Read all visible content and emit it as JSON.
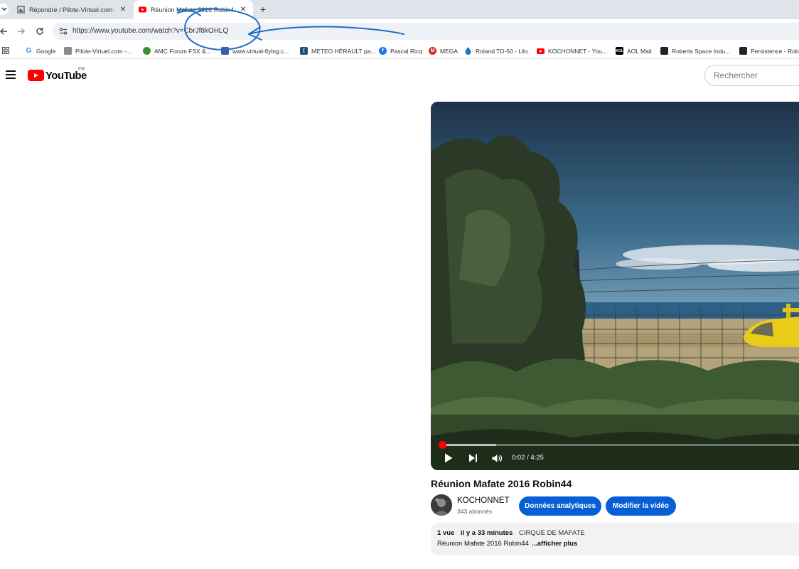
{
  "browser": {
    "tabs": [
      {
        "title": "Répondre / Pilote-Virtuel.com -",
        "favicon": "pilote-virtuel-icon",
        "active": false
      },
      {
        "title": "Réunion Mafate 2016 Robin44",
        "favicon": "youtube-icon",
        "active": true
      }
    ],
    "url": "https://www.youtube.com/watch?v=CbrJf8kOHLQ",
    "bookmarks": [
      {
        "label": "Google",
        "icon": "google-icon",
        "color": "#4285f4"
      },
      {
        "label": "Pilote-Virtuel.com -...",
        "icon": "pilote-virtuel-icon",
        "color": "#7a7a7a"
      },
      {
        "label": "AMC Forum FSX &...",
        "icon": "globe-icon",
        "color": "#3a8f3a"
      },
      {
        "label": "www.virtual-flying.c...",
        "icon": "virtual-flying-icon",
        "color": "#3b5ba8"
      },
      {
        "label": "METEO HÉRAULT pa...",
        "icon": "meteo-icon",
        "color": "#1c4f7c"
      },
      {
        "label": "Pascal Ricq",
        "icon": "facebook-icon",
        "color": "#1877f2"
      },
      {
        "label": "MEGA",
        "icon": "mega-icon",
        "color": "#d9272e"
      },
      {
        "label": "Roland TD-50 - Lilo",
        "icon": "drop-icon",
        "color": "#1a73c8"
      },
      {
        "label": "KOCHONNET - You...",
        "icon": "youtube-icon",
        "color": "#ff0000"
      },
      {
        "label": "AOL Mail",
        "icon": "aol-icon",
        "color": "#000000"
      },
      {
        "label": "Roberts Space Indu...",
        "icon": "rsi-icon",
        "color": "#222222"
      },
      {
        "label": "Persistence - Robe",
        "icon": "rsi-icon",
        "color": "#222222"
      }
    ]
  },
  "youtube": {
    "logo_text": "YouTube",
    "region": "FR",
    "search_placeholder": "Rechercher",
    "player": {
      "time": "0:02 / 4:25",
      "progress_fraction": 0.008
    },
    "video_title": "Réunion Mafate 2016 Robin44",
    "channel_name": "KOCHONNET",
    "subscribers": "343 abonnés",
    "analytics_button": "Données analytiques",
    "edit_button": "Modifier la vidéo",
    "description": {
      "views": "1 vue",
      "age": "il y a 33 minutes",
      "tag": "CIRQUE DE MAFATE",
      "text": "Réunion Mafate 2016 Robin44",
      "more": "...afficher plus"
    }
  },
  "colors": {
    "accent_blue": "#065fd4",
    "youtube_red": "#ff0000",
    "annotation_ink": "#1f6fc4"
  }
}
